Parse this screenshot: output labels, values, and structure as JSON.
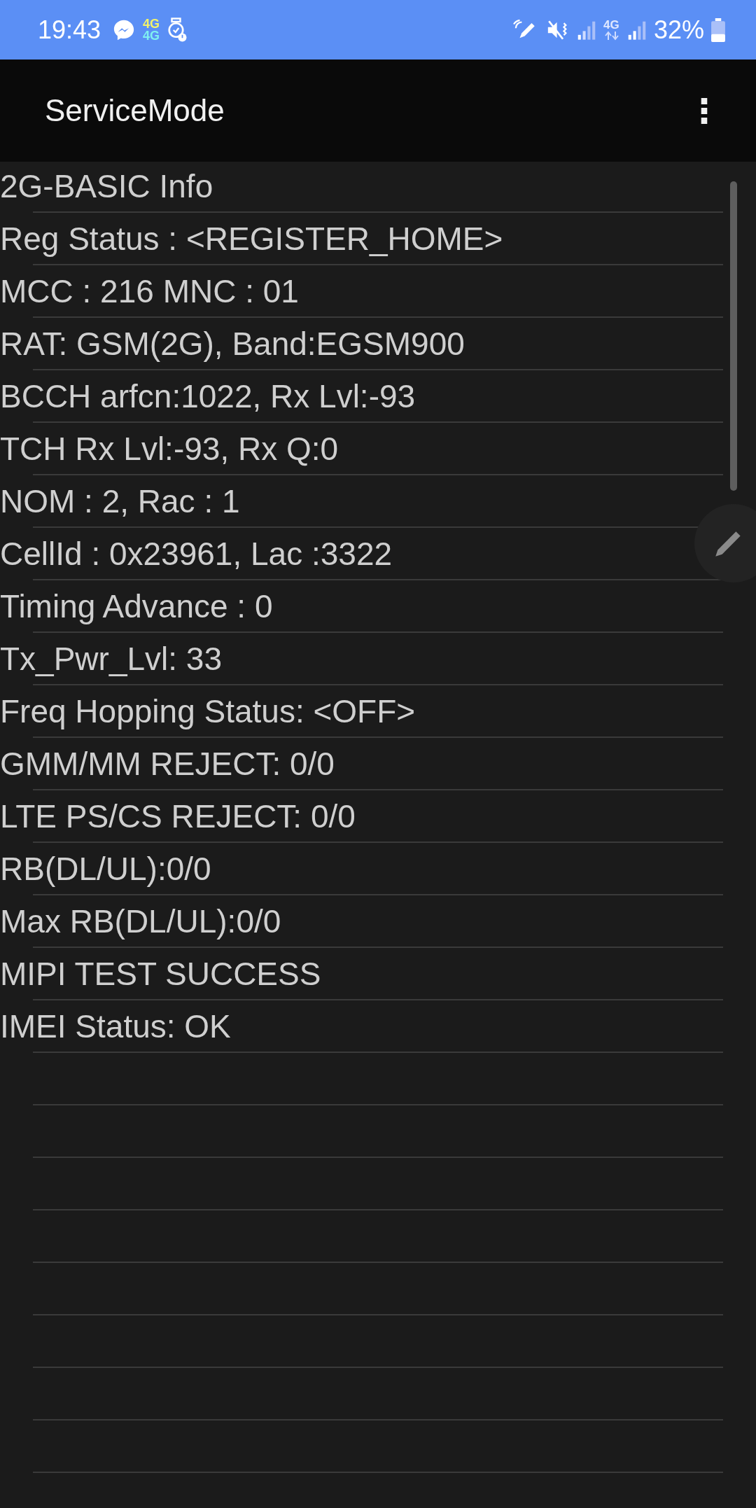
{
  "status_bar": {
    "time": "19:43",
    "network_top": "4G",
    "network_bottom": "4G",
    "data_network": "4G",
    "battery": "32%"
  },
  "app_bar": {
    "title": "ServiceMode",
    "menu": "⋮"
  },
  "lines": [
    "2G-BASIC Info",
    "Reg Status : <REGISTER_HOME>",
    "MCC : 216 MNC : 01",
    "RAT: GSM(2G), Band:EGSM900",
    "BCCH arfcn:1022, Rx Lvl:-93",
    "TCH Rx Lvl:-93, Rx Q:0",
    "NOM : 2, Rac : 1",
    "CellId : 0x23961, Lac :3322",
    "Timing Advance : 0",
    "Tx_Pwr_Lvl: 33",
    "Freq Hopping Status: <OFF>",
    "GMM/MM REJECT: 0/0",
    "LTE PS/CS REJECT: 0/0",
    "RB(DL/UL):0/0",
    "Max RB(DL/UL):0/0",
    "MIPI TEST SUCCESS",
    "IMEI Status: OK"
  ]
}
